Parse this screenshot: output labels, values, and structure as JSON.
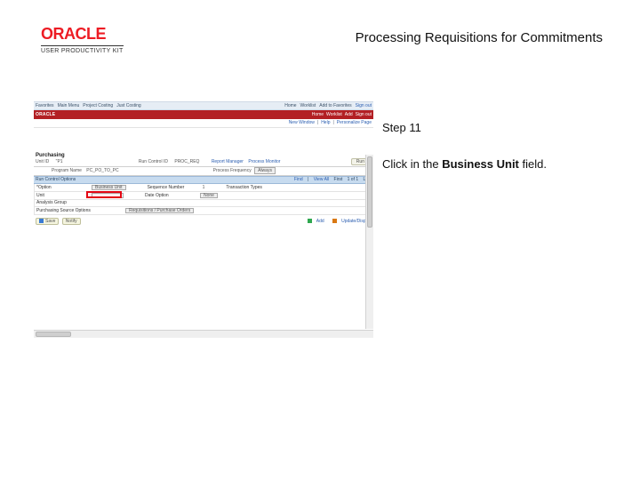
{
  "brand": {
    "name": "ORACLE",
    "subtitle": "USER PRODUCTIVITY KIT"
  },
  "doc": {
    "title": "Processing Requisitions for Commitments"
  },
  "step": {
    "label": "Step 11"
  },
  "instruction": {
    "pre": "Click in the ",
    "bold": "Business Unit",
    "post": " field."
  },
  "app": {
    "menubar": {
      "items": [
        "Favorites",
        "Main Menu",
        "Project Costing",
        "Just Costing",
        "…"
      ],
      "right": [
        "Home",
        "Worklist",
        "Add to Favorites",
        "Sign out"
      ]
    },
    "brand": "ORACLE",
    "redlinks": [
      "Home",
      "Worklist",
      "Add",
      "Sign out"
    ],
    "subnav": {
      "left": "New Window",
      "mid": "Help",
      "right": "Personalize Page"
    },
    "module": "Purchasing",
    "unit": {
      "label": "Unit ID",
      "value": "\"P1"
    },
    "runcontrol": {
      "label": "Run Control ID",
      "value": "PROC_REQ"
    },
    "report": "Report Manager",
    "processmon": "Process Monitor",
    "runbtn": "Run",
    "program": {
      "label": "Program Name",
      "value": "PC_PO_TO_PC"
    },
    "request": {
      "label": "Process Frequency",
      "value": "Always"
    },
    "bluebar": {
      "title": "Run Control Options",
      "find": "Find",
      "viewall": "View All",
      "first": "First",
      "pager": "1 of 1",
      "last": "Last"
    },
    "fields": {
      "option": "*Option",
      "optionvalue": "Business Unit",
      "seqlabel": "Sequence Number",
      "seqvalue": "1",
      "txnlabel": "Transaction Types",
      "bulabel": "Unit",
      "buvalue": "",
      "datelabel": "Date Option",
      "datevalue": "None",
      "analabel": "Analysis Group",
      "sourcelabel": "Purchasing Source Options",
      "sourcevalue": "Requisitions / Purchase Orders"
    },
    "bottom": {
      "save": "Save",
      "notify": "Notify",
      "add": "Add",
      "update": "Update/Display"
    }
  }
}
